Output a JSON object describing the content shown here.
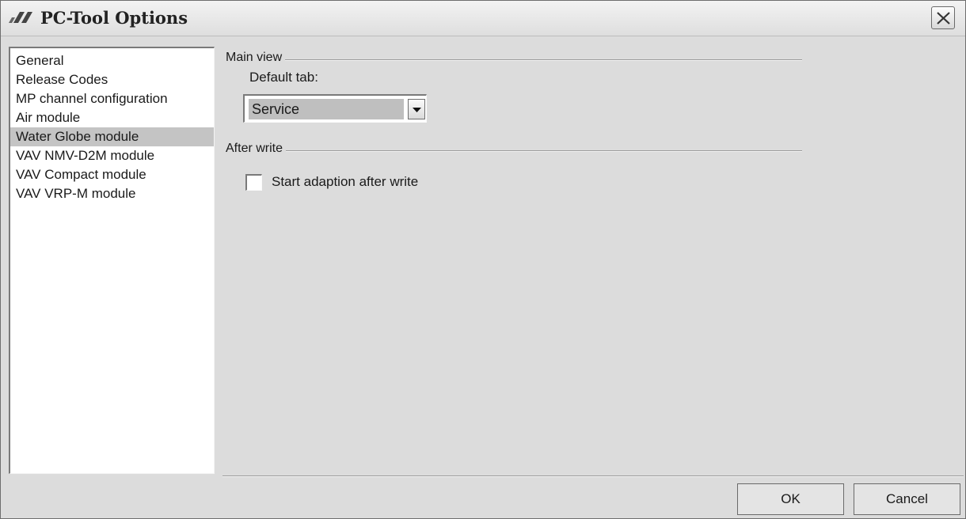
{
  "window": {
    "title": "PC-Tool Options"
  },
  "sidebar": {
    "selected_index": 4,
    "items": [
      {
        "label": "General"
      },
      {
        "label": "Release Codes"
      },
      {
        "label": "MP channel configuration"
      },
      {
        "label": "Air module"
      },
      {
        "label": "Water Globe module"
      },
      {
        "label": "VAV NMV-D2M module"
      },
      {
        "label": "VAV Compact module"
      },
      {
        "label": "VAV VRP-M module"
      }
    ]
  },
  "main_view": {
    "group_title": "Main view",
    "default_tab_label": "Default tab:",
    "default_tab_value": "Service"
  },
  "after_write": {
    "group_title": "After write",
    "checkbox_label": "Start adaption after write",
    "checked": false
  },
  "footer": {
    "ok_label": "OK",
    "cancel_label": "Cancel"
  },
  "icons": {
    "app_logo": "app-logo-icon",
    "close": "close-icon",
    "dropdown": "chevron-down-icon"
  }
}
